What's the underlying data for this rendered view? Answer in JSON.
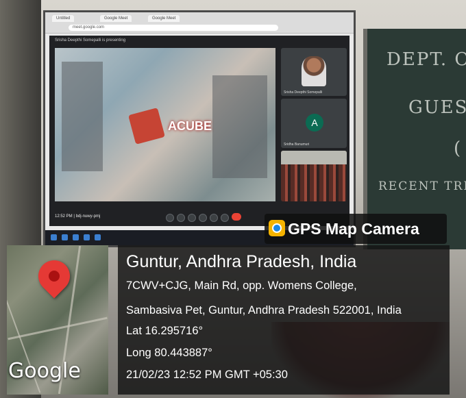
{
  "screen": {
    "tabs": [
      "Untitled",
      "Google Meet",
      "Google Meet"
    ],
    "url": "meet.google.com",
    "presenting_text": "Srisha Deepthi Somepalli is presenting",
    "logo_text": "ACUBE",
    "tiles": [
      {
        "label": "Srisha Deepthi Somepalli"
      },
      {
        "label": "Sridha Banumuri",
        "avatar_letter": "A"
      },
      {
        "label": ""
      }
    ],
    "clock": "12:52 PM | bdj-nuwy-pmj"
  },
  "board": {
    "lines": [
      "DEPT. OF",
      "GUEST",
      "(",
      "RECENT TRE"
    ]
  },
  "gps_badge": {
    "text": "GPS Map Camera",
    "icon": "map-pin-camera-icon"
  },
  "map": {
    "brand": "Google",
    "pin_icon": "location-pin-icon"
  },
  "location": {
    "title": "Guntur, Andhra Pradesh, India",
    "address_line1": "7CWV+CJG, Main Rd, opp. Womens College,",
    "address_line2": "Sambasiva Pet, Guntur, Andhra Pradesh 522001, India",
    "lat": "Lat 16.295716°",
    "long": "Long 80.443887°",
    "datetime": "21/02/23 12:52 PM GMT +05:30"
  },
  "colors": {
    "pin": "#e53935",
    "end_call": "#ea4335",
    "avatar": "#0b6b53",
    "gps_icon": "#f5b300"
  }
}
